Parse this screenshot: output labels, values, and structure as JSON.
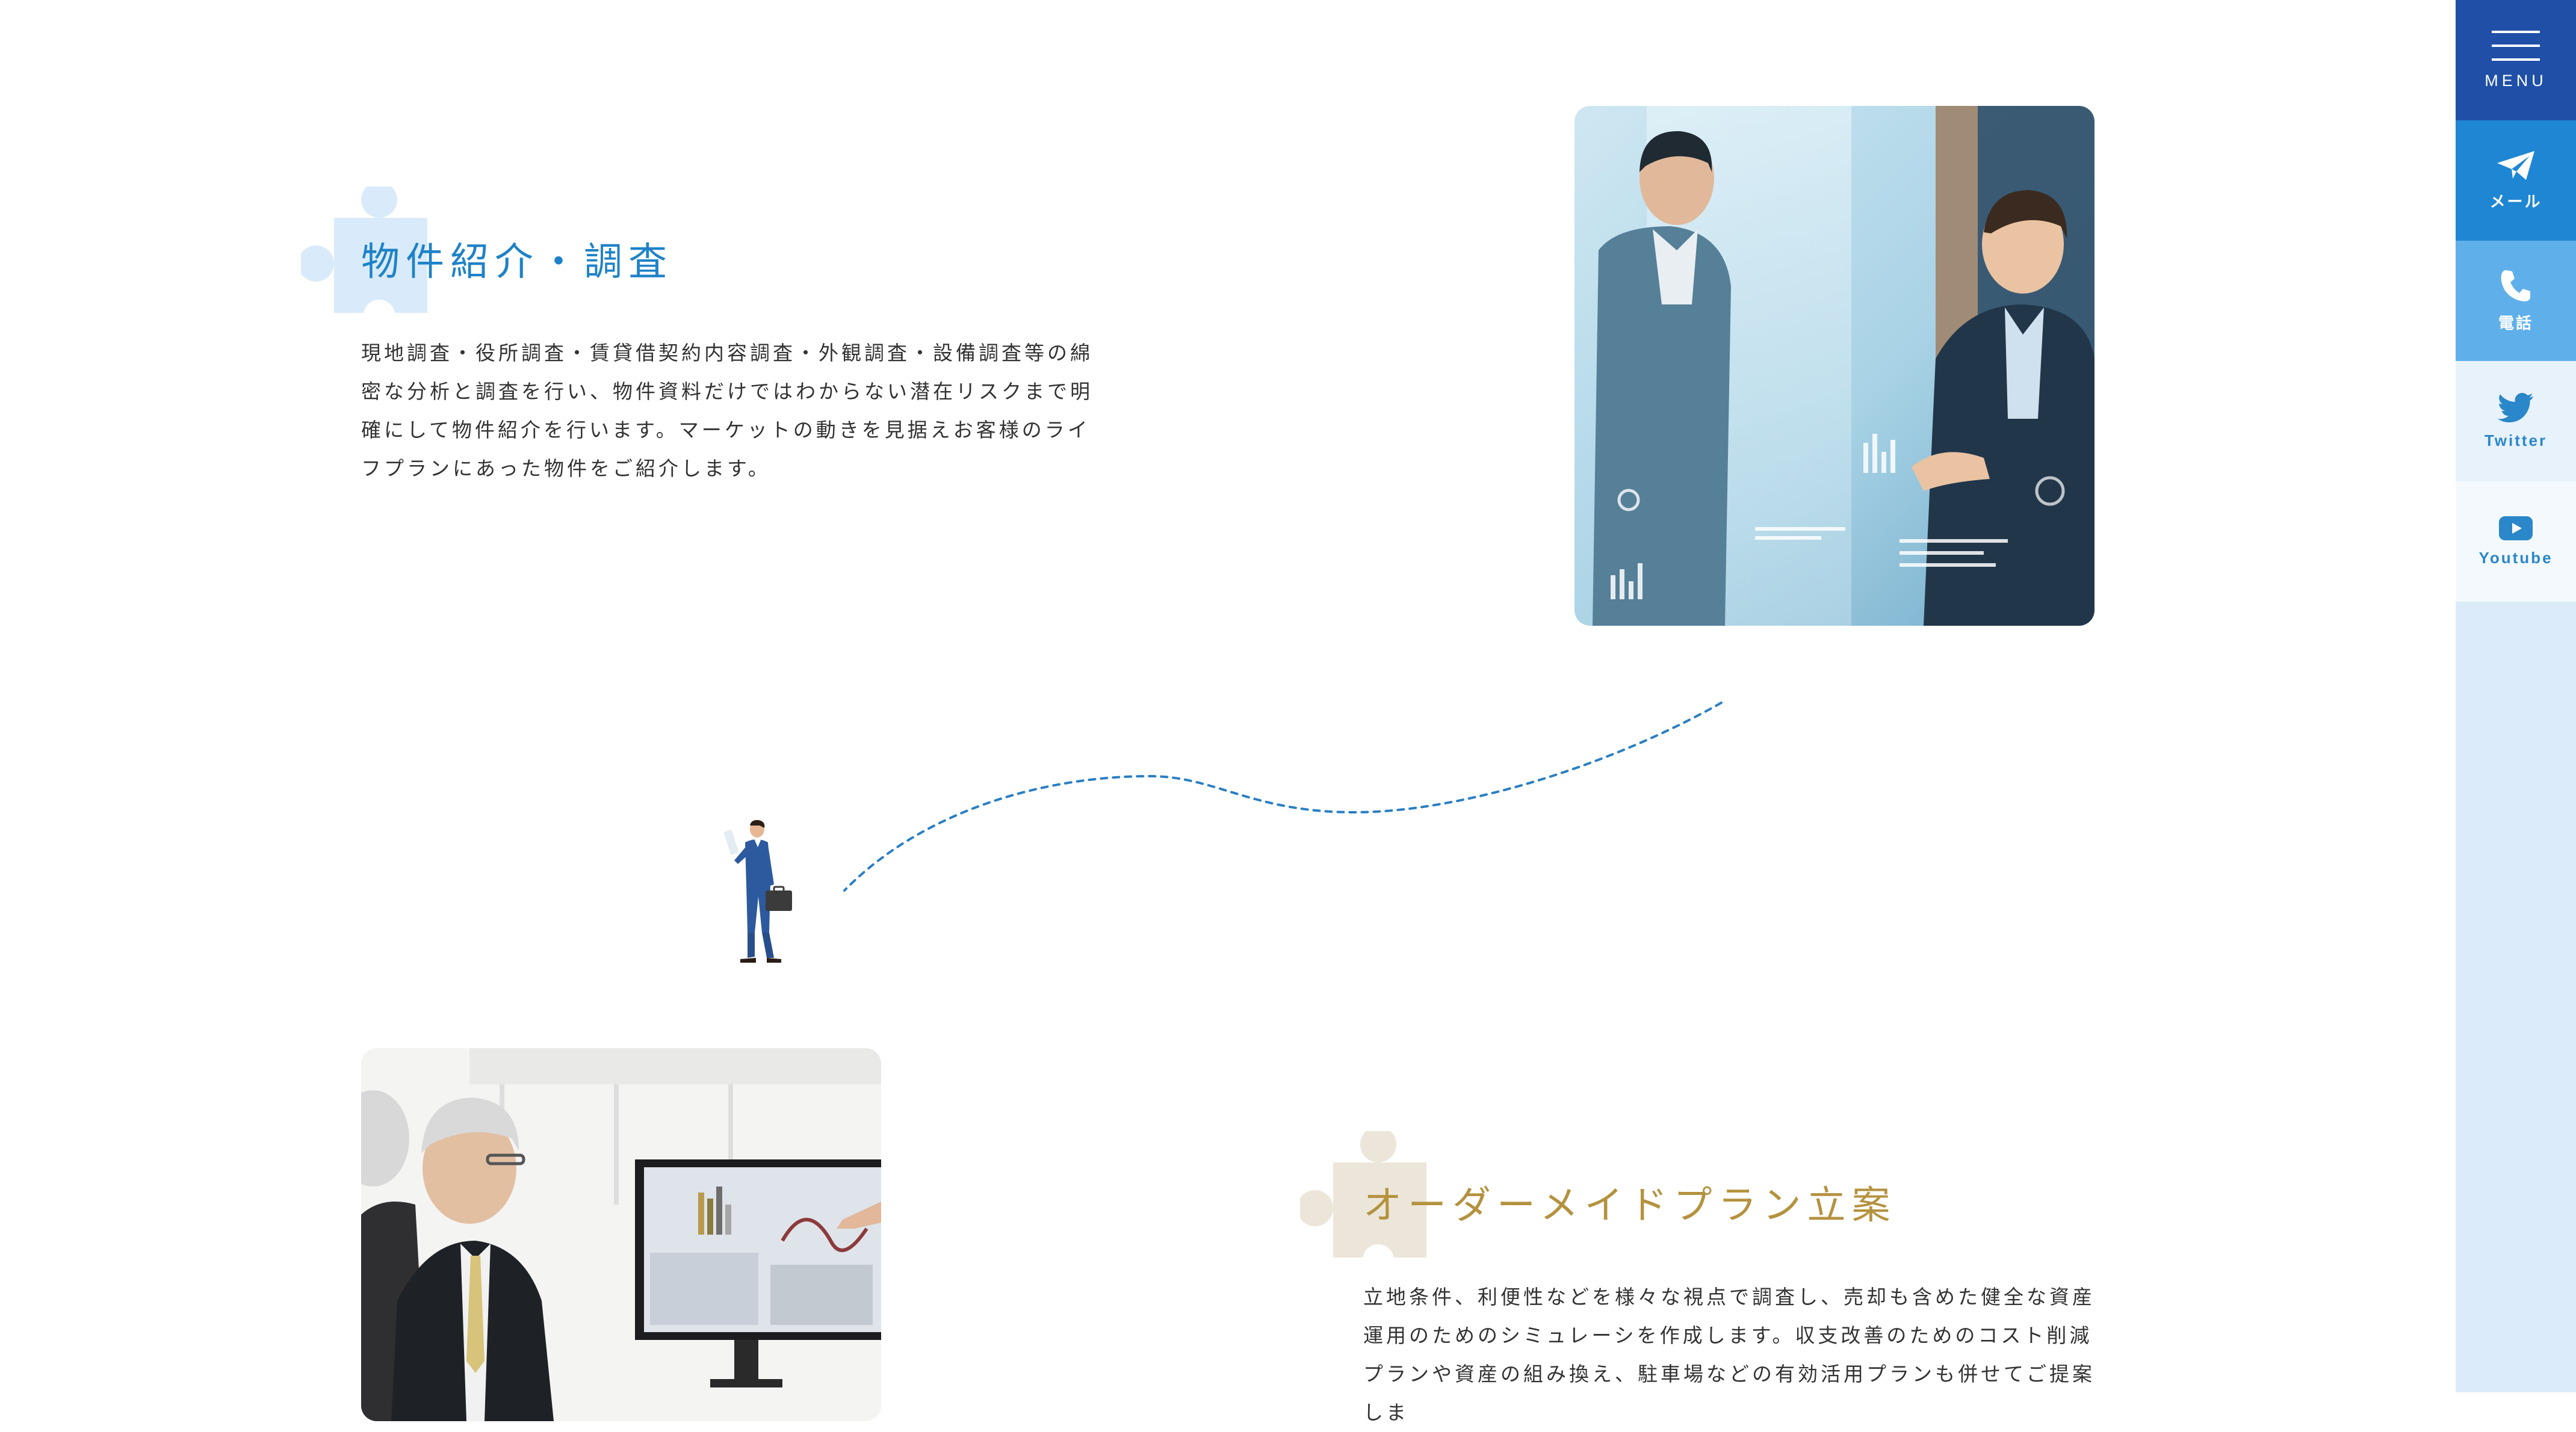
{
  "sections": [
    {
      "title": "物件紹介・調査",
      "body": "現地調査・役所調査・賃貸借契約内容調査・外観調査・設備調査等の綿密な分析と調査を行い、物件資料だけではわからない潜在リスクまで明確にして物件紹介を行います。マーケットの動きを見据えお客様のライフプランにあった物件をご紹介します。",
      "accent": "#1e82c8",
      "puzzle_color": "#d9ebfb"
    },
    {
      "title": "オーダーメイドプラン立案",
      "body": "立地条件、利便性などを様々な視点で調査し、売却も含めた健全な資産運用のためのシミュレーシを作成します。収支改善のためのコスト削減プランや資産の組み換え、駐車場などの有効活用プランも併せてご提案しま",
      "accent": "#b4923e",
      "puzzle_color": "#ece6da"
    }
  ],
  "side_nav": {
    "menu": {
      "label": "MENU",
      "icon": "hamburger-icon"
    },
    "mail": {
      "label": "メール",
      "icon": "paper-plane-icon"
    },
    "tel": {
      "label": "電話",
      "icon": "phone-icon"
    },
    "twitter": {
      "label": "Twitter",
      "icon": "twitter-bird-icon"
    },
    "youtube": {
      "label": "Youtube",
      "icon": "youtube-play-icon"
    }
  },
  "colors": {
    "route_line": "#2a7fc3",
    "rail_background": "#dcebf9",
    "menu_background": "#1f4fa7",
    "mail_background": "#1f86d3",
    "tel_background": "#5fb0ea"
  }
}
